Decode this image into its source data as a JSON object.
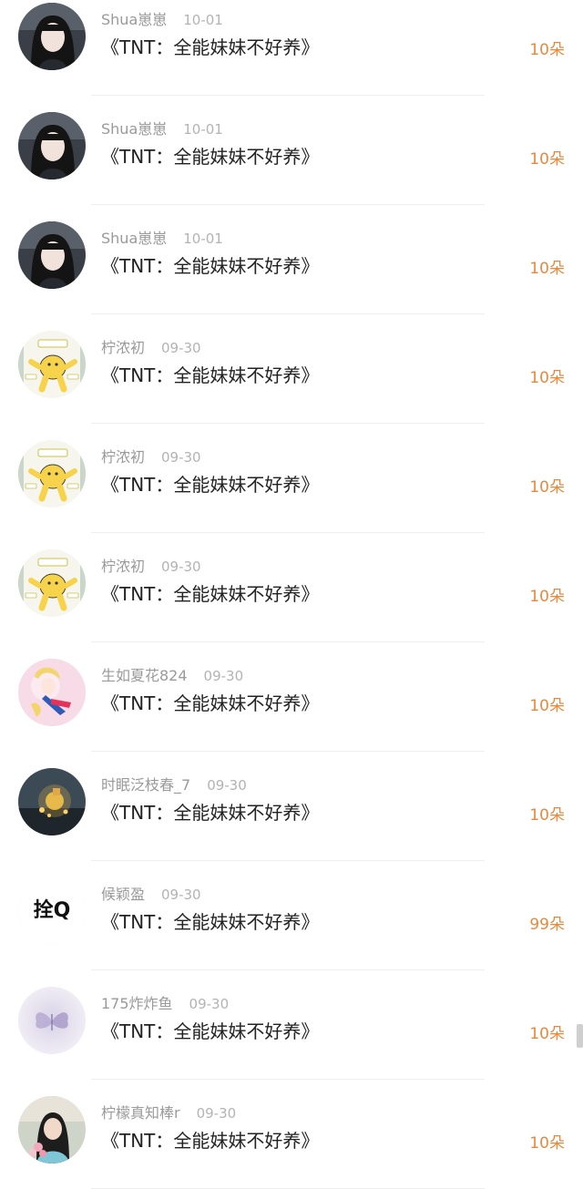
{
  "colors": {
    "gift": "#e8883d",
    "name": "#9a9a9a",
    "title": "#222222"
  },
  "rows": [
    {
      "user": "Shua崽崽",
      "date": "10-01",
      "title": "《TNT：全能妹妹不好养》",
      "gift": "10朵",
      "avatar": "dark-hair-girl"
    },
    {
      "user": "Shua崽崽",
      "date": "10-01",
      "title": "《TNT：全能妹妹不好养》",
      "gift": "10朵",
      "avatar": "dark-hair-girl"
    },
    {
      "user": "Shua崽崽",
      "date": "10-01",
      "title": "《TNT：全能妹妹不好养》",
      "gift": "10朵",
      "avatar": "dark-hair-girl"
    },
    {
      "user": "柠浓初",
      "date": "09-30",
      "title": "《TNT：全能妹妹不好养》",
      "gift": "10朵",
      "avatar": "yellow-cartoon"
    },
    {
      "user": "柠浓初",
      "date": "09-30",
      "title": "《TNT：全能妹妹不好养》",
      "gift": "10朵",
      "avatar": "yellow-cartoon"
    },
    {
      "user": "柠浓初",
      "date": "09-30",
      "title": "《TNT：全能妹妹不好养》",
      "gift": "10朵",
      "avatar": "yellow-cartoon"
    },
    {
      "user": "生如夏花824",
      "date": "09-30",
      "title": "《TNT：全能妹妹不好养》",
      "gift": "10朵",
      "avatar": "pink-anime"
    },
    {
      "user": "时眠泛枝春_7",
      "date": "09-30",
      "title": "《TNT：全能妹妹不好养》",
      "gift": "10朵",
      "avatar": "night-lights"
    },
    {
      "user": "候颖盈",
      "date": "09-30",
      "title": "《TNT：全能妹妹不好养》",
      "gift": "99朵",
      "avatar": "text-avatar",
      "avatar_text": "拴Q"
    },
    {
      "user": "175炸炸鱼",
      "date": "09-30",
      "title": "《TNT：全能妹妹不好养》",
      "gift": "10朵",
      "avatar": "purple-butterfly"
    },
    {
      "user": "柠檬真知棒r",
      "date": "09-30",
      "title": "《TNT：全能妹妹不好养》",
      "gift": "10朵",
      "avatar": "girl-with-flowers"
    }
  ]
}
